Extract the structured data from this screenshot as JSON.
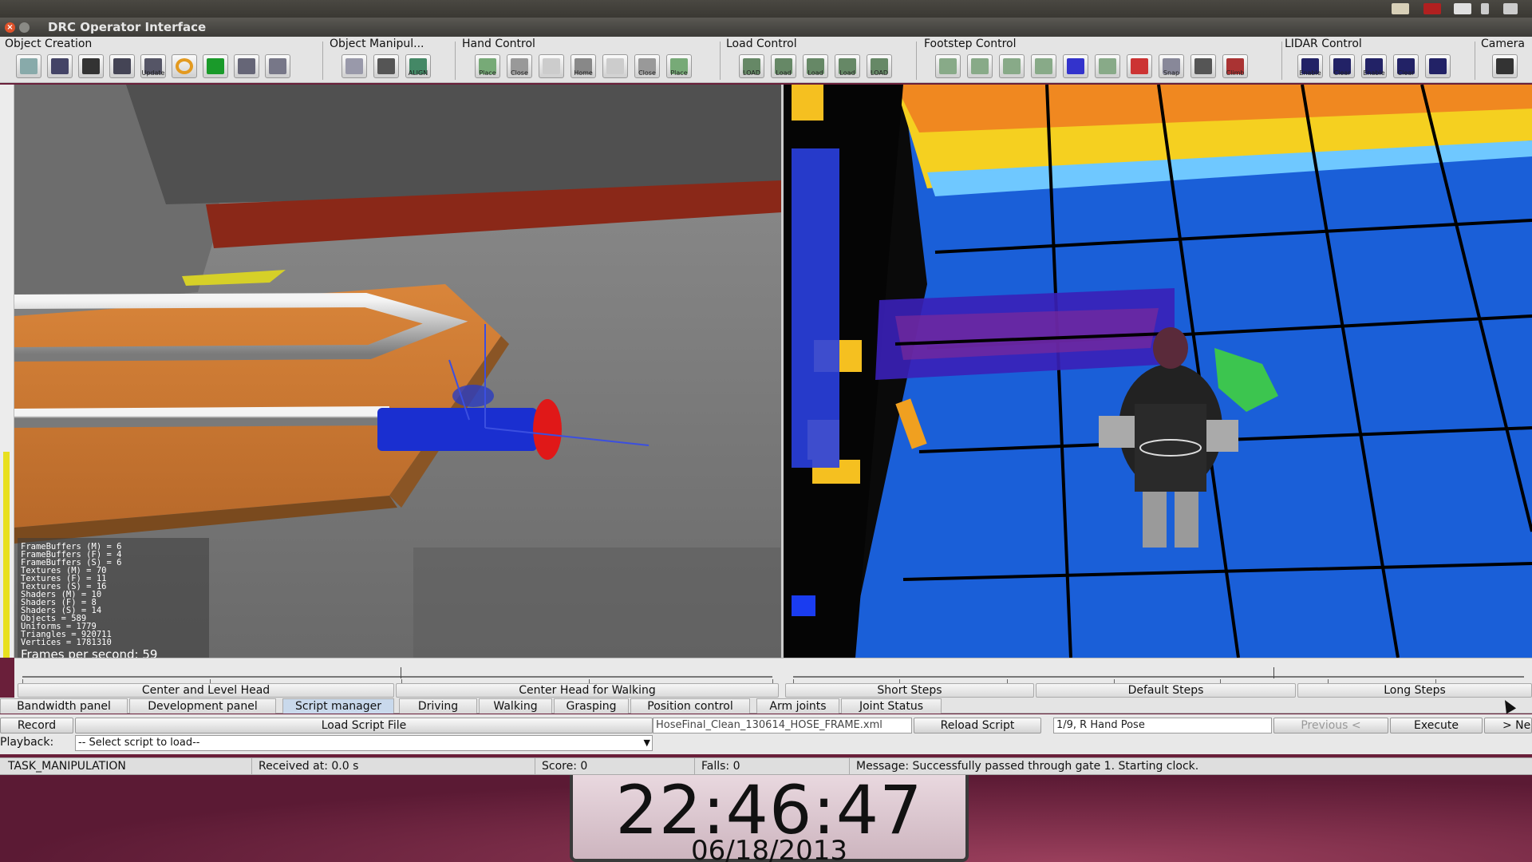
{
  "window": {
    "title": "DRC Operator Interface",
    "close_glyph": "×"
  },
  "toolbar": {
    "groups": [
      {
        "label": "Object Creation",
        "buttons": [
          {
            "icon": "object-select-icon",
            "text": ""
          },
          {
            "icon": "cube-icon",
            "text": ""
          },
          {
            "icon": "grid-icon",
            "text": ""
          },
          {
            "icon": "vehicle-icon",
            "text": ""
          },
          {
            "icon": "ladder-icon",
            "text": "Update"
          },
          {
            "icon": "ring-icon",
            "text": ""
          },
          {
            "icon": "green-block-icon",
            "text": ""
          },
          {
            "icon": "valve-icon",
            "text": ""
          },
          {
            "icon": "drill-icon",
            "text": ""
          }
        ]
      },
      {
        "label": "Object Manipul...",
        "buttons": [
          {
            "icon": "move-icon",
            "text": ""
          },
          {
            "icon": "rotate-icon",
            "text": ""
          },
          {
            "icon": "align-icon",
            "text": "ALIGN"
          }
        ]
      },
      {
        "label": "Hand Control",
        "buttons": [
          {
            "icon": "hand-place-icon",
            "text": "Place"
          },
          {
            "icon": "hand-close-icon",
            "text": "Close"
          },
          {
            "icon": "hand-blank-icon",
            "text": ""
          },
          {
            "icon": "hand-home-icon",
            "text": "Home"
          },
          {
            "icon": "hand-blank-icon",
            "text": ""
          },
          {
            "icon": "hand-close-icon",
            "text": "Close"
          },
          {
            "icon": "hand-place-icon",
            "text": "Place"
          }
        ]
      },
      {
        "label": "Load Control",
        "buttons": [
          {
            "icon": "load-icon",
            "text": "LOAD"
          },
          {
            "icon": "load-icon",
            "text": "Load"
          },
          {
            "icon": "load-icon",
            "text": "Load"
          },
          {
            "icon": "load-icon",
            "text": "Load"
          },
          {
            "icon": "load-icon",
            "text": "LOAD"
          }
        ]
      },
      {
        "label": "Footstep Control",
        "buttons": [
          {
            "icon": "footstep-icon",
            "text": ""
          },
          {
            "icon": "footstep-icon",
            "text": ""
          },
          {
            "icon": "footstep-icon",
            "text": ""
          },
          {
            "icon": "footstep-icon",
            "text": ""
          },
          {
            "icon": "footstep-grid-icon",
            "text": ""
          },
          {
            "icon": "footstep-icon",
            "text": ""
          },
          {
            "icon": "footstep-cancel-icon",
            "text": ""
          },
          {
            "icon": "snap-icon",
            "text": "Snap"
          },
          {
            "icon": "turn-icon",
            "text": ""
          },
          {
            "icon": "climb-icon",
            "text": "Climb"
          }
        ]
      },
      {
        "label": "LIDAR Control",
        "buttons": [
          {
            "icon": "lidar-icon",
            "text": "Enable"
          },
          {
            "icon": "lidar-icon",
            "text": "Clear"
          },
          {
            "icon": "lidar-icon",
            "text": "Enable"
          },
          {
            "icon": "lidar-icon",
            "text": "Clear"
          },
          {
            "icon": "lidar-icon",
            "text": ""
          }
        ]
      },
      {
        "label": "Camera",
        "buttons": [
          {
            "icon": "eye-icon",
            "text": ""
          }
        ]
      }
    ]
  },
  "left_view": {
    "stats": [
      "FrameBuffers (M) = 6",
      "FrameBuffers (F) = 4",
      "FrameBuffers (S) = 6",
      "Textures (M) = 70",
      "Textures (F) = 11",
      "Textures (S) = 16",
      "Shaders (M) = 10",
      "Shaders (F) = 8",
      "Shaders (S) = 14",
      "Objects = 589",
      "Uniforms = 1779",
      "Triangles = 920711",
      "Vertices = 1781310"
    ],
    "fps": "Frames per second: 59"
  },
  "sliders": {
    "left": {
      "label_a": "Center and Level Head",
      "label_b": "Center Head for Walking"
    },
    "right": {
      "label_a": "Short Steps",
      "label_b": "Default Steps",
      "label_c": "Long Steps"
    }
  },
  "tabs": [
    {
      "label": "Bandwidth panel",
      "active": false
    },
    {
      "label": "Development panel",
      "active": false
    },
    {
      "label": "Script manager",
      "active": true
    },
    {
      "label": "Driving",
      "active": false
    },
    {
      "label": "Walking",
      "active": false
    },
    {
      "label": "Grasping",
      "active": false
    },
    {
      "label": "Position control",
      "active": false
    },
    {
      "label": "Arm joints",
      "active": false
    },
    {
      "label": "Joint Status",
      "active": false
    }
  ],
  "script": {
    "record_label": "Record",
    "load_label": "Load Script File",
    "file_name": "HoseFinal_Clean_130614_HOSE_FRAME.xml",
    "reload_label": "Reload Script",
    "step_value": "1/9, R Hand Pose",
    "previous_label": "Previous <",
    "execute_label": "Execute",
    "next_label": "> Ne",
    "playback_label": "Playback:",
    "playback_value": "-- Select script to load--",
    "dropdown_glyph": "▼"
  },
  "status": {
    "task": "TASK_MANIPULATION",
    "received": "Received at:  0.0 s",
    "score": "Score:  0",
    "falls": "Falls:  0",
    "message": "Message:  Successfully passed through gate 1. Starting clock."
  },
  "clock": {
    "time": "22:46:47",
    "date": "06/18/2013"
  },
  "colors": {
    "accent_tab": "#c9d9ec",
    "close_button": "#e0522a"
  }
}
